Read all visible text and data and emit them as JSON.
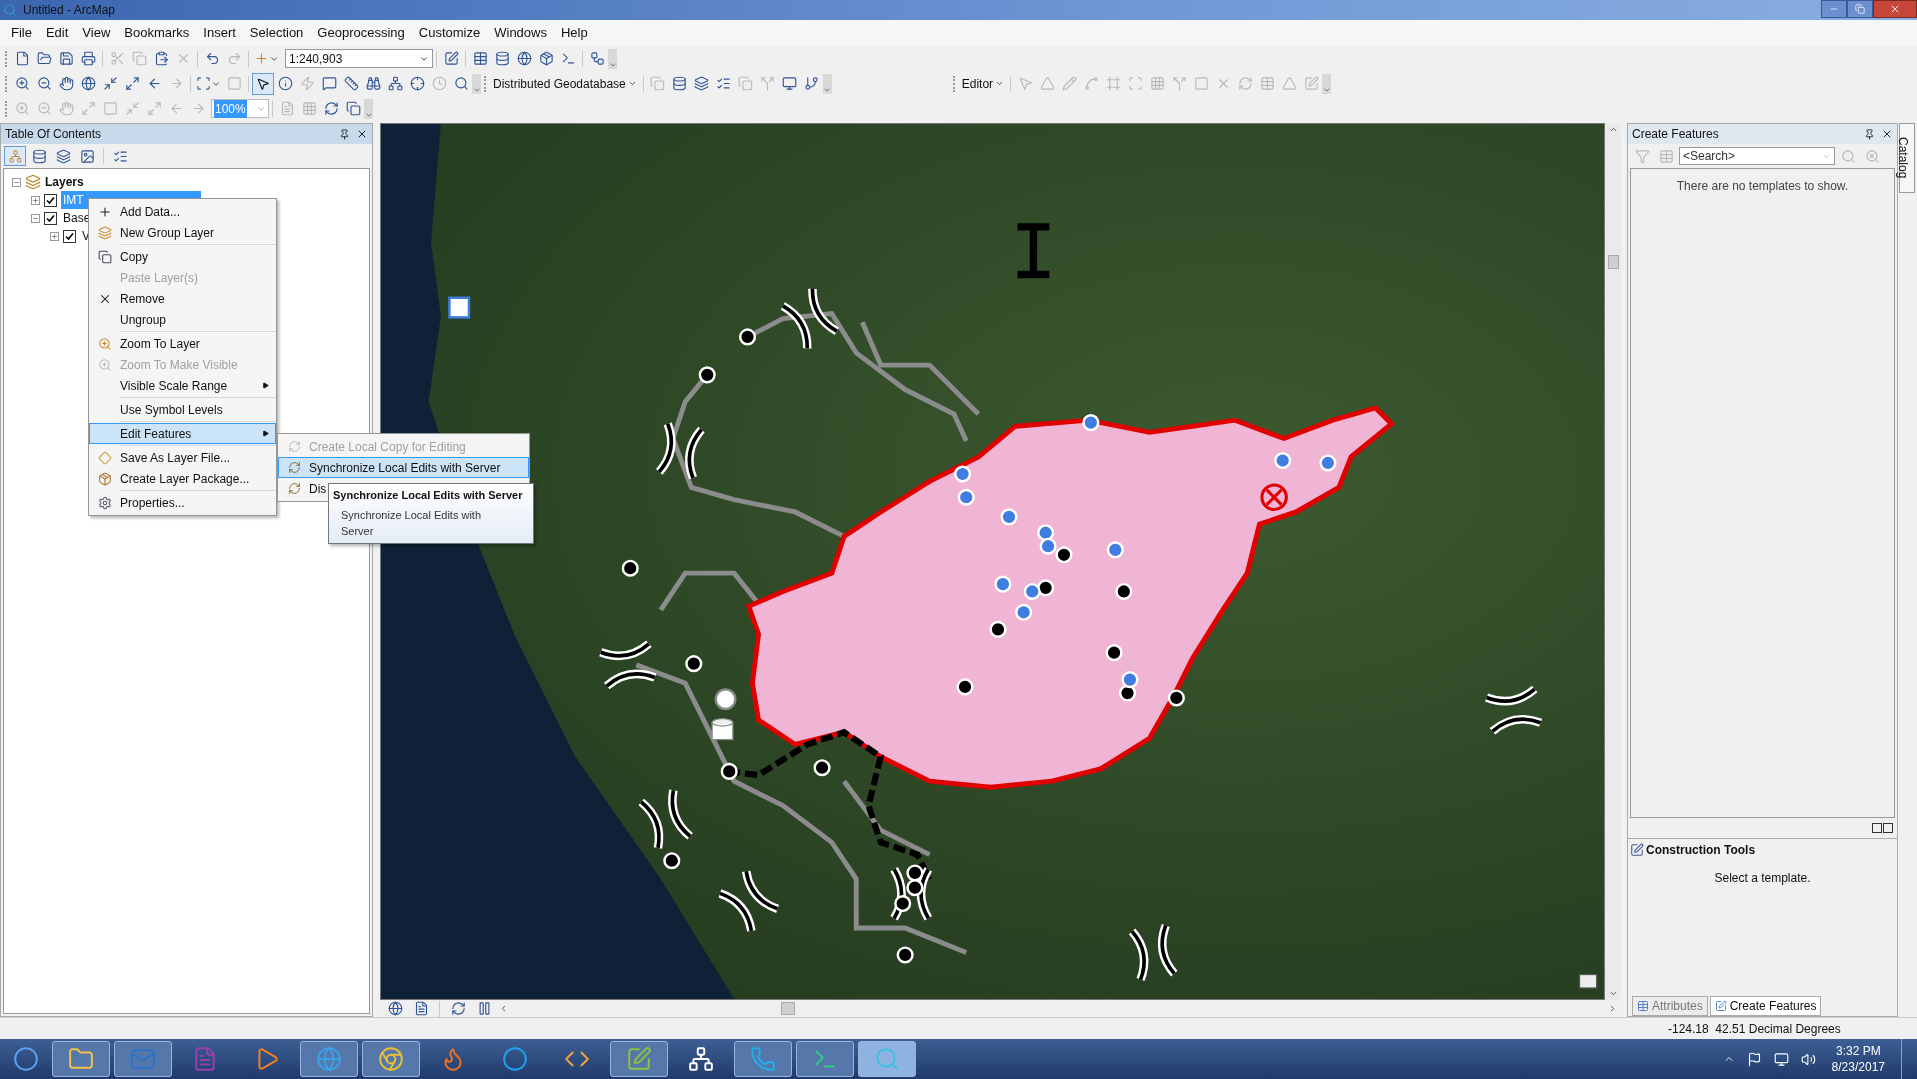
{
  "window": {
    "title": "Untitled - ArcMap"
  },
  "menu_bar": [
    "File",
    "Edit",
    "View",
    "Bookmarks",
    "Insert",
    "Selection",
    "Geoprocessing",
    "Customize",
    "Windows",
    "Help"
  ],
  "toolbars": {
    "scale": "1:240,903",
    "zoom_percent": "100%",
    "geodatabase_menu": "Distributed Geodatabase",
    "editor_menu": "Editor"
  },
  "table_of_contents": {
    "title": "Table Of Contents",
    "tree": [
      {
        "label": "Layers",
        "kind": "data_frame",
        "expanded": true,
        "children": [
          {
            "label": "IMT",
            "kind": "layer",
            "checked": true,
            "expanded": false,
            "selected": true
          },
          {
            "label": "Base",
            "kind": "layer",
            "checked": true,
            "expanded": true,
            "selected": false,
            "children": [
              {
                "label": "V",
                "kind": "layer",
                "checked": true,
                "expanded": false,
                "selected": false
              }
            ]
          }
        ]
      }
    ]
  },
  "context_menu": {
    "groups": [
      [
        {
          "label": "Add Data...",
          "disabled": false,
          "selected": false,
          "has_submenu": false
        },
        {
          "label": "New Group Layer",
          "disabled": false,
          "selected": false,
          "has_submenu": false
        }
      ],
      [
        {
          "label": "Copy",
          "disabled": false,
          "selected": false,
          "has_submenu": false
        },
        {
          "label": "Paste Layer(s)",
          "disabled": true,
          "selected": false,
          "has_submenu": false
        },
        {
          "label": "Remove",
          "disabled": false,
          "selected": false,
          "has_submenu": false
        },
        {
          "label": "Ungroup",
          "disabled": false,
          "selected": false,
          "has_submenu": false
        }
      ],
      [
        {
          "label": "Zoom To Layer",
          "disabled": false,
          "selected": false,
          "has_submenu": false
        },
        {
          "label": "Zoom To Make Visible",
          "disabled": true,
          "selected": false,
          "has_submenu": false
        },
        {
          "label": "Visible Scale Range",
          "disabled": false,
          "selected": false,
          "has_submenu": true
        }
      ],
      [
        {
          "label": "Use Symbol Levels",
          "disabled": false,
          "selected": false,
          "has_submenu": false
        }
      ],
      [
        {
          "label": "Edit Features",
          "disabled": false,
          "selected": true,
          "has_submenu": true
        }
      ],
      [
        {
          "label": "Save As Layer File...",
          "disabled": false,
          "selected": false,
          "has_submenu": false
        },
        {
          "label": "Create Layer Package...",
          "disabled": false,
          "selected": false,
          "has_submenu": false
        }
      ],
      [
        {
          "label": "Properties...",
          "disabled": false,
          "selected": false,
          "has_submenu": false
        }
      ]
    ]
  },
  "submenu": {
    "items": [
      {
        "label": "Create Local Copy for Editing",
        "disabled": true,
        "selected": false
      },
      {
        "label": "Synchronize Local Edits with Server",
        "disabled": false,
        "selected": true
      },
      {
        "label": "Dis",
        "disabled": false,
        "selected": false
      }
    ]
  },
  "tooltip": {
    "title": "Synchronize Local Edits with Server",
    "body": "Synchronize Local Edits with Server"
  },
  "create_features": {
    "title": "Create Features",
    "search": {
      "placeholder": "<Search>"
    },
    "message": "There are no templates to show."
  },
  "construction_tools": {
    "title": "Construction Tools",
    "message": "Select a template."
  },
  "panel_tabs": [
    {
      "label": "Attributes",
      "selected": false
    },
    {
      "label": "Create Features",
      "selected": true
    }
  ],
  "side_tab": {
    "label": "Catalog"
  },
  "status_bar": {
    "coordinates": "-124.18  42.51 Decimal Degrees"
  },
  "taskbar": {
    "apps": [
      {
        "running": false,
        "selected": false
      },
      {
        "running": true,
        "selected": false
      },
      {
        "running": true,
        "selected": false
      },
      {
        "running": false,
        "selected": false
      },
      {
        "running": false,
        "selected": false
      },
      {
        "running": true,
        "selected": false
      },
      {
        "running": true,
        "selected": false
      },
      {
        "running": false,
        "selected": false
      },
      {
        "running": false,
        "selected": false
      },
      {
        "running": false,
        "selected": false
      },
      {
        "running": true,
        "selected": false
      },
      {
        "running": false,
        "selected": false
      },
      {
        "running": true,
        "selected": false
      },
      {
        "running": true,
        "selected": false
      },
      {
        "running": true,
        "selected": true
      }
    ],
    "clock": {
      "time": "3:32 PM",
      "date": "8/23/2017"
    }
  }
}
